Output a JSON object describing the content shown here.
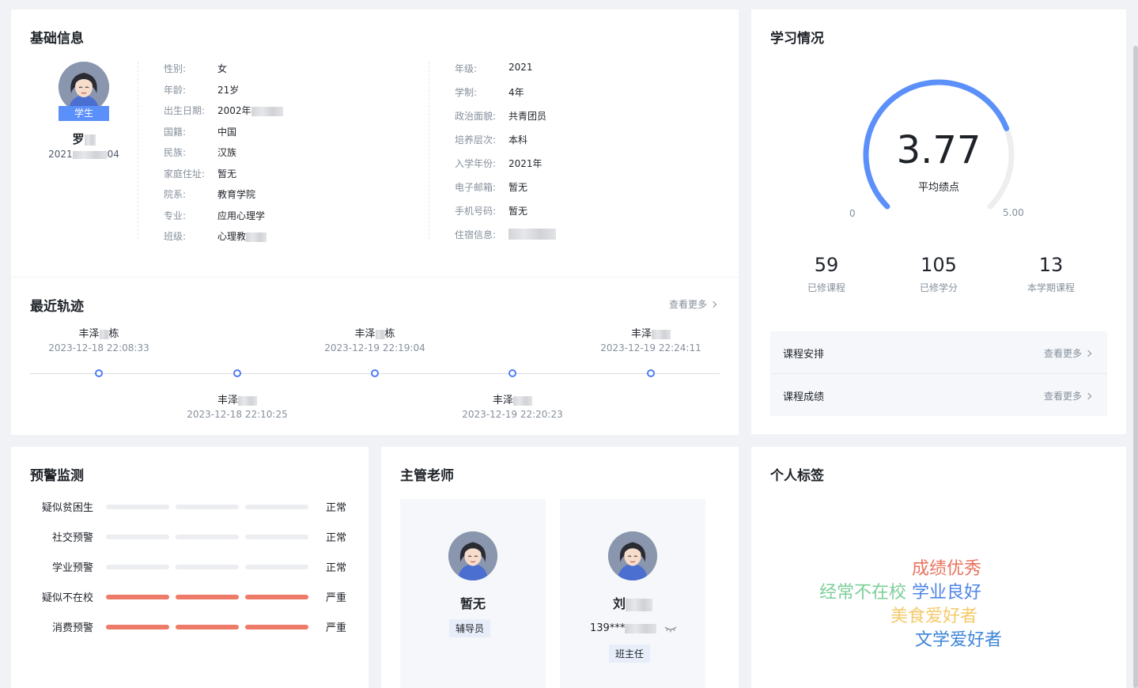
{
  "basic": {
    "title": "基础信息",
    "badge": "学生",
    "name": "罗",
    "id_prefix": "2021",
    "id_suffix": "04",
    "left_fields": [
      {
        "label": "性别:",
        "value": "女"
      },
      {
        "label": "年龄:",
        "value": "21岁"
      },
      {
        "label": "出生日期:",
        "value": "2002年"
      },
      {
        "label": "国籍:",
        "value": "中国"
      },
      {
        "label": "民族:",
        "value": "汉族"
      },
      {
        "label": "家庭住址:",
        "value": "暂无"
      },
      {
        "label": "院系:",
        "value": "教育学院"
      },
      {
        "label": "专业:",
        "value": "应用心理学"
      },
      {
        "label": "班级:",
        "value": "心理教"
      }
    ],
    "right_fields": [
      {
        "label": "年级:",
        "value": "2021"
      },
      {
        "label": "学制:",
        "value": "4年"
      },
      {
        "label": "政治面貌:",
        "value": "共青团员"
      },
      {
        "label": "培养层次:",
        "value": "本科"
      },
      {
        "label": "入学年份:",
        "value": "2021年"
      },
      {
        "label": "电子邮箱:",
        "value": "暂无"
      },
      {
        "label": "手机号码:",
        "value": "暂无"
      },
      {
        "label": "住宿信息:",
        "value": ""
      }
    ]
  },
  "trace": {
    "title": "最近轨迹",
    "more": "查看更多",
    "top_items": [
      {
        "name": "丰泽",
        "suffix": "栋",
        "time": "2023-12-18 22:08:33"
      },
      {
        "name": "丰泽",
        "suffix": "栋",
        "time": "2023-12-19 22:19:04"
      },
      {
        "name": "丰泽",
        "suffix": "",
        "time": "2023-12-19 22:24:11"
      }
    ],
    "bottom_items": [
      {
        "name": "丰泽",
        "time": "2023-12-18 22:10:25"
      },
      {
        "name": "丰泽",
        "time": "2023-12-19 22:20:23"
      }
    ]
  },
  "study": {
    "title": "学习情况",
    "gpa": "3.77",
    "gpa_label": "平均绩点",
    "gpa_value": 3.77,
    "gpa_max": 5.0,
    "min_label": "0",
    "max_label": "5.00",
    "stats": [
      {
        "num": "59",
        "label": "已修课程"
      },
      {
        "num": "105",
        "label": "已修学分"
      },
      {
        "num": "13",
        "label": "本学期课程"
      }
    ],
    "links": [
      {
        "label": "课程安排",
        "more": "查看更多"
      },
      {
        "label": "课程成绩",
        "more": "查看更多"
      }
    ],
    "accent": "#5b8ff9"
  },
  "warning": {
    "title": "预警监测",
    "items": [
      {
        "label": "疑似贫困生",
        "status": "正常",
        "level": 0
      },
      {
        "label": "社交预警",
        "status": "正常",
        "level": 0
      },
      {
        "label": "学业预警",
        "status": "正常",
        "level": 0
      },
      {
        "label": "疑似不在校",
        "status": "严重",
        "level": 3
      },
      {
        "label": "消费预警",
        "status": "严重",
        "level": 3
      }
    ],
    "colors": {
      "normal": "#ebedf0",
      "severe": "#ee7a68"
    }
  },
  "teacher": {
    "title": "主管老师",
    "cards": [
      {
        "name": "暂无",
        "role": "辅导员"
      },
      {
        "name": "刘",
        "phone": "139***",
        "role": "班主任"
      }
    ]
  },
  "tags": {
    "title": "个人标签",
    "items": [
      {
        "text": "成绩优秀",
        "color": "#e8735f"
      },
      {
        "text": "经常不在校",
        "color": "#7ccf9a"
      },
      {
        "text": "学业良好",
        "color": "#4e84e6"
      },
      {
        "text": "美食爱好者",
        "color": "#f5c96a"
      },
      {
        "text": "文学爱好者",
        "color": "#3c85d8"
      }
    ]
  }
}
